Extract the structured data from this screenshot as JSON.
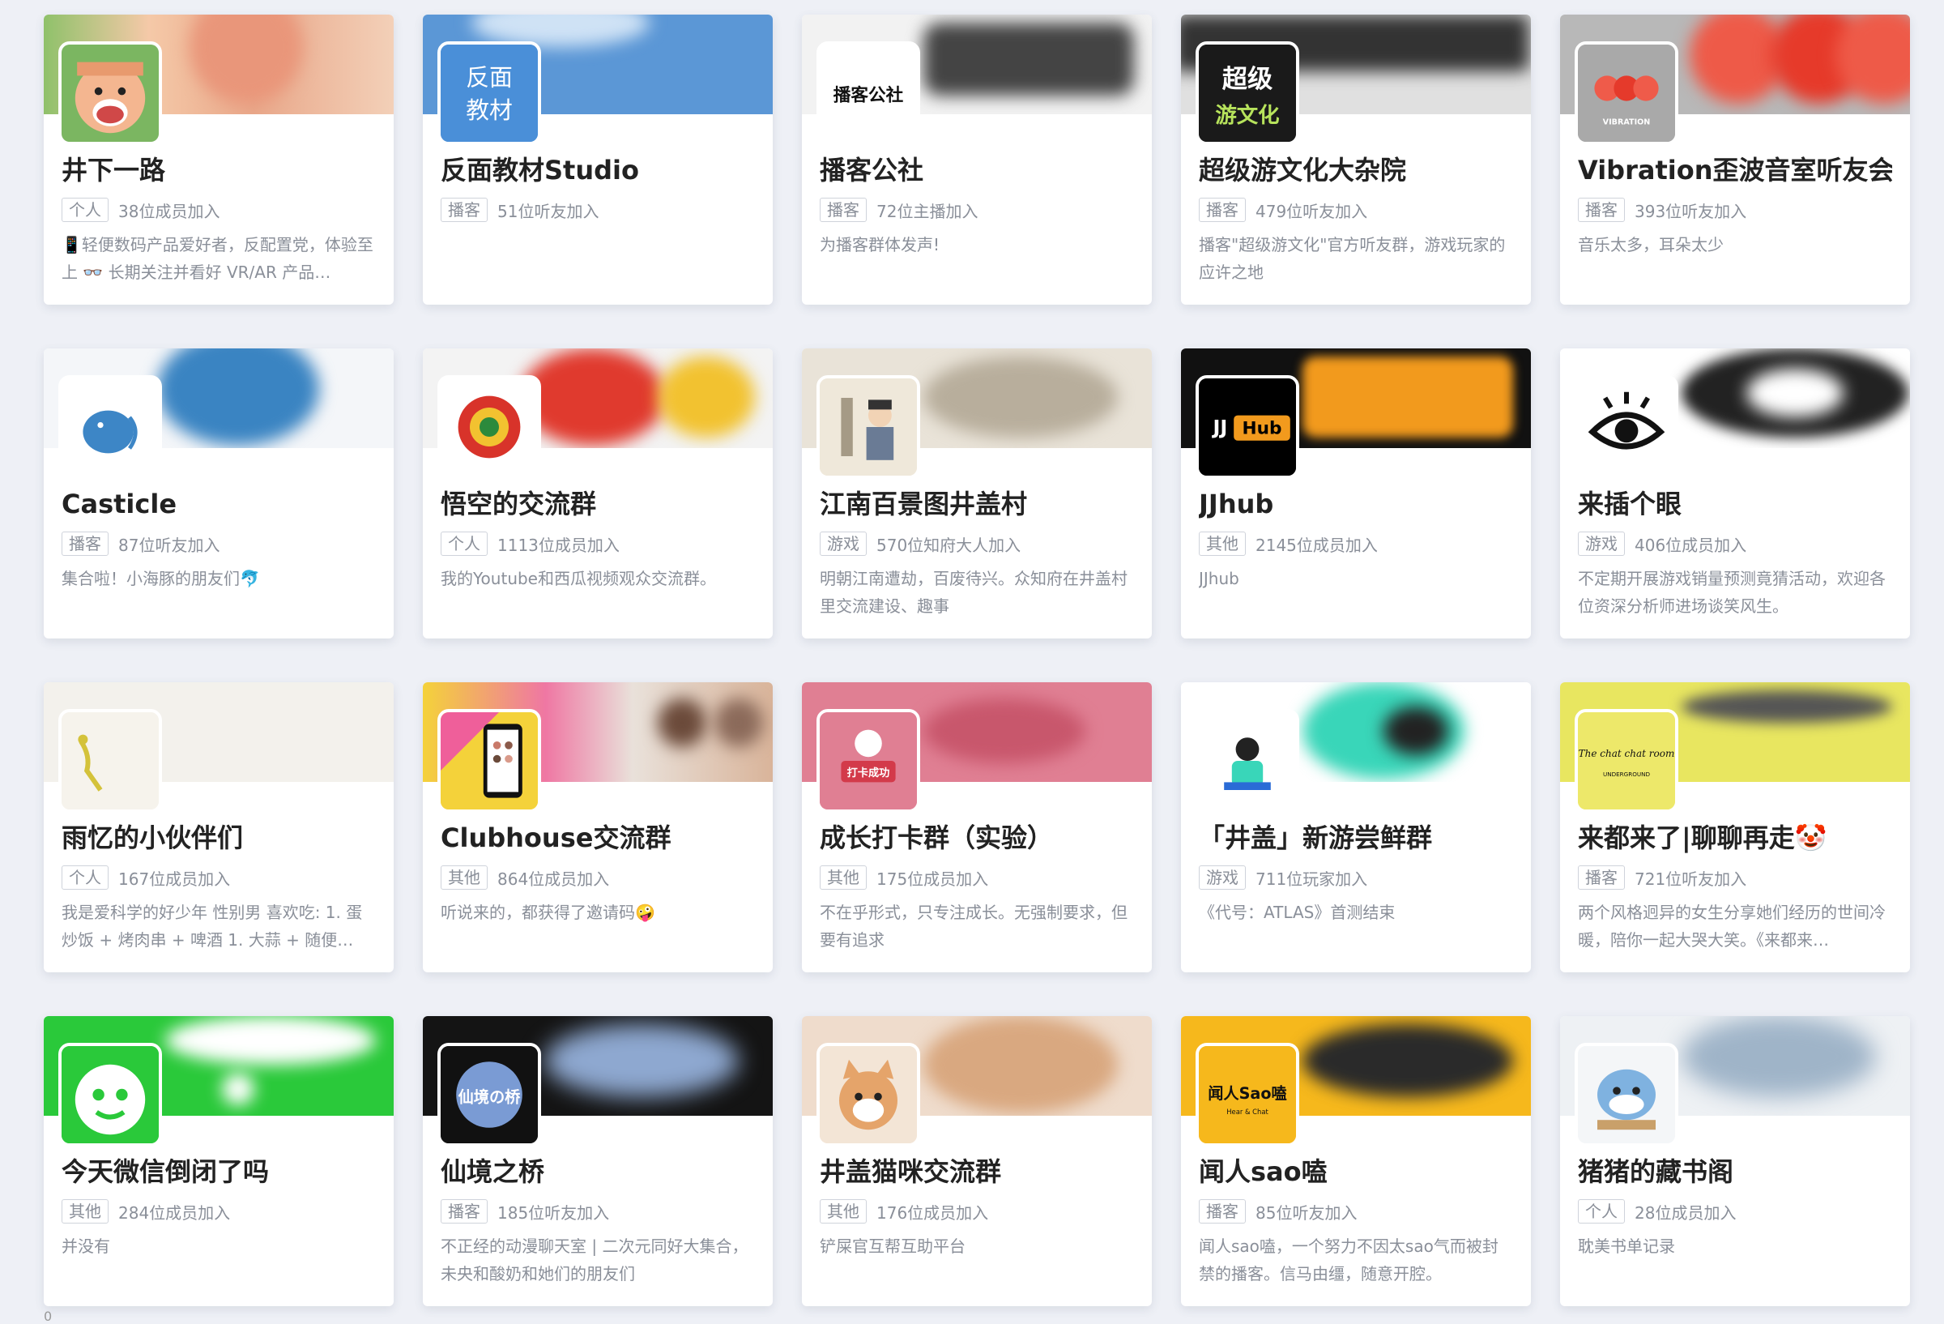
{
  "cards": [
    {
      "title": "井下一路",
      "tag": "个人",
      "count": "38位成员加入",
      "desc": "📱轻便数码产品爱好者，反配置党，体验至上 👓 长期关注并看好 VR/AR 产品…"
    },
    {
      "title": "反面教材Studio",
      "tag": "播客",
      "count": "51位听友加入",
      "desc": ""
    },
    {
      "title": "播客公社",
      "tag": "播客",
      "count": "72位主播加入",
      "desc": "为播客群体发声!"
    },
    {
      "title": "超级游文化大杂院",
      "tag": "播客",
      "count": "479位听友加入",
      "desc": "播客\"超级游文化\"官方听友群，游戏玩家的应许之地"
    },
    {
      "title": "Vibration歪波音室听友会",
      "tag": "播客",
      "count": "393位听友加入",
      "desc": "音乐太多，耳朵太少"
    },
    {
      "title": "Casticle",
      "tag": "播客",
      "count": "87位听友加入",
      "desc": "集合啦！小海豚的朋友们🐬"
    },
    {
      "title": "悟空的交流群",
      "tag": "个人",
      "count": "1113位成员加入",
      "desc": "我的Youtube和西瓜视频观众交流群。"
    },
    {
      "title": "江南百景图井盖村",
      "tag": "游戏",
      "count": "570位知府大人加入",
      "desc": "明朝江南遭劫，百废待兴。众知府在井盖村里交流建设、趣事"
    },
    {
      "title": "JJhub",
      "tag": "其他",
      "count": "2145位成员加入",
      "desc": "JJhub"
    },
    {
      "title": "来插个眼",
      "tag": "游戏",
      "count": "406位成员加入",
      "desc": "不定期开展游戏销量预测竟猜活动，欢迎各位资深分析师进场谈笑风生。"
    },
    {
      "title": "雨忆的小伙伴们",
      "tag": "个人",
      "count": "167位成员加入",
      "desc": "我是爱科学的好少年 性别男 喜欢吃: 1. 蛋炒饭 + 烤肉串 + 啤酒 1. 大蒜 + 随便…"
    },
    {
      "title": "Clubhouse交流群",
      "tag": "其他",
      "count": "864位成员加入",
      "desc": "听说来的，都获得了邀请码🤪"
    },
    {
      "title": "成长打卡群（实验）",
      "tag": "其他",
      "count": "175位成员加入",
      "desc": "不在乎形式，只专注成长。无强制要求，但要有追求"
    },
    {
      "title": "「井盖」新游尝鲜群",
      "tag": "游戏",
      "count": "711位玩家加入",
      "desc": "《代号：ATLAS》首测结束"
    },
    {
      "title": "来都来了|聊聊再走🤡",
      "tag": "播客",
      "count": "721位听友加入",
      "desc": "两个风格迥异的女生分享她们经历的世间冷暖，陪你一起大哭大笑。《来都来…"
    },
    {
      "title": "今天微信倒闭了吗",
      "tag": "其他",
      "count": "284位成员加入",
      "desc": "并没有"
    },
    {
      "title": "仙境之桥",
      "tag": "播客",
      "count": "185位听友加入",
      "desc": "不正经的动漫聊天室 | 二次元同好大集合，未央和酸奶和她们的朋友们"
    },
    {
      "title": "井盖猫咪交流群",
      "tag": "其他",
      "count": "176位成员加入",
      "desc": "铲屎官互帮互助平台"
    },
    {
      "title": "闻人sao嗑",
      "tag": "播客",
      "count": "85位听友加入",
      "desc": "闻人sao嗑，一个努力不因太sao气而被封禁的播客。信马由缰，随意开腔。"
    },
    {
      "title": "猪猪的藏书阁",
      "tag": "个人",
      "count": "28位成员加入",
      "desc": "耽美书单记录"
    }
  ],
  "avatar_text": {
    "fanmian": [
      "反面",
      "教材"
    ],
    "boke": "播客公社",
    "chaoji": [
      "超级",
      "游文化"
    ],
    "vibration": "VIBRATION",
    "jj": "JJ",
    "hub": "Hub",
    "chatroom": "The chat chat room",
    "underground": "UNDERGROUND",
    "daka": "打卡成功",
    "xianjing": "仙境の桥",
    "sao": "闻人Sao嗑",
    "hearchat": "Hear & Chat"
  },
  "footer_mark": "0"
}
